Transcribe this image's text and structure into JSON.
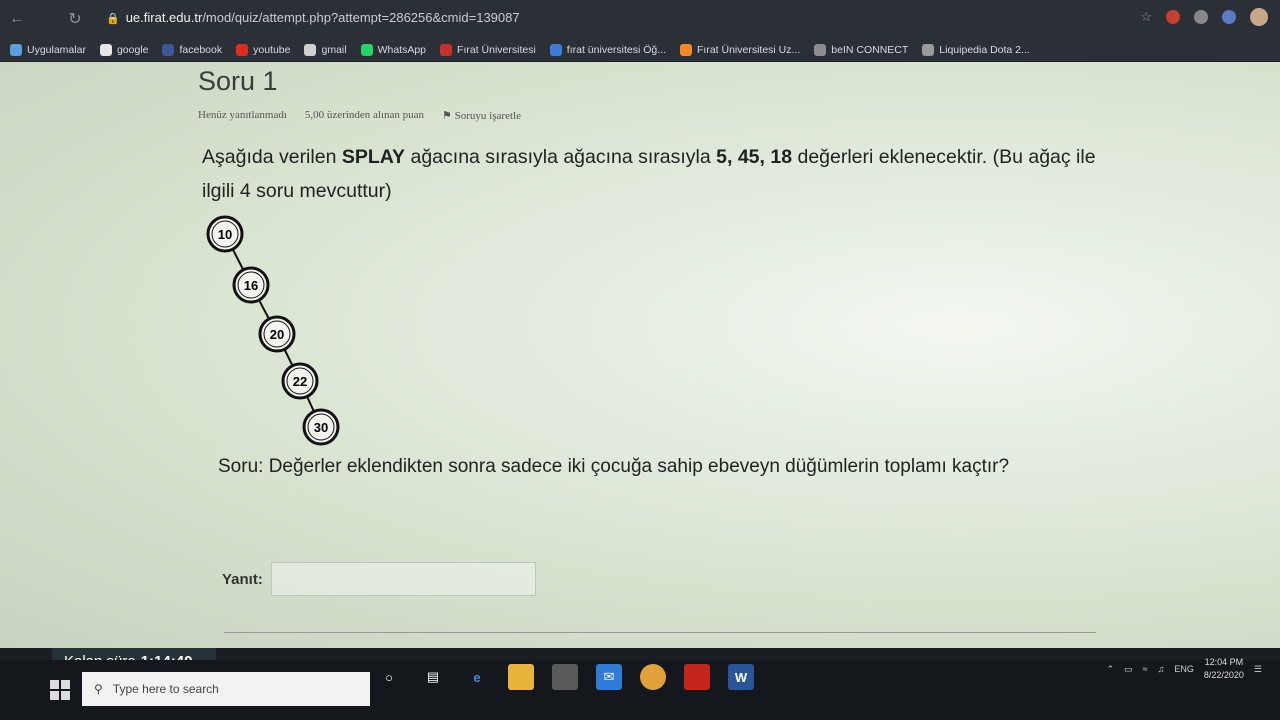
{
  "browser": {
    "url_domain": "ue.firat.edu.tr",
    "url_path": "/mod/quiz/attempt.php?attempt=286256&cmid=139087"
  },
  "bookmarks": [
    {
      "label": "Uygulamalar",
      "color": "#5aa0e0"
    },
    {
      "label": "google",
      "color": "#e6e6e6"
    },
    {
      "label": "facebook",
      "color": "#3b5998"
    },
    {
      "label": "youtube",
      "color": "#e02b20"
    },
    {
      "label": "gmail",
      "color": "#d0d0d0"
    },
    {
      "label": "WhatsApp",
      "color": "#25d366"
    },
    {
      "label": "Fırat Üniversitesi",
      "color": "#c9302c"
    },
    {
      "label": "fırat üniversitesi Öğ...",
      "color": "#3b7dd8"
    },
    {
      "label": "Fırat Üniversitesi Uz...",
      "color": "#f08a24"
    },
    {
      "label": "beIN CONNECT",
      "color": "#8c8c8c"
    },
    {
      "label": "Liquipedia Dota 2...",
      "color": "#9a9a9a"
    }
  ],
  "question": {
    "title": "Soru 1",
    "status": "Henüz yanıtlanmadı",
    "points": "5,00 üzerinden alınan puan",
    "flag": "Soruyu işaretle",
    "intro_1": "Aşağıda verilen ",
    "intro_bold_1": "SPLAY",
    "intro_2": " ağacına sırasıyla ağacına sırasıyla ",
    "intro_bold_2": "5, 45, 18",
    "intro_3": " değerleri eklenecektir. (Bu ağaç ile ilgili 4 soru mevcuttur)",
    "prompt": "Soru: Değerler eklendikten sonra sadece iki çocuğa sahip ebeveyn düğümlerin toplamı kaçtır?",
    "answer_label": "Yanıt:",
    "answer_value": ""
  },
  "tree": {
    "nodes": [
      "10",
      "16",
      "20",
      "22",
      "30"
    ]
  },
  "timer": {
    "label": "Kalan süre",
    "value": "1:14:40"
  },
  "taskbar": {
    "search_placeholder": "Type here to search",
    "lang": "ENG",
    "time": "12:04 PM",
    "date": "8/22/2020"
  }
}
